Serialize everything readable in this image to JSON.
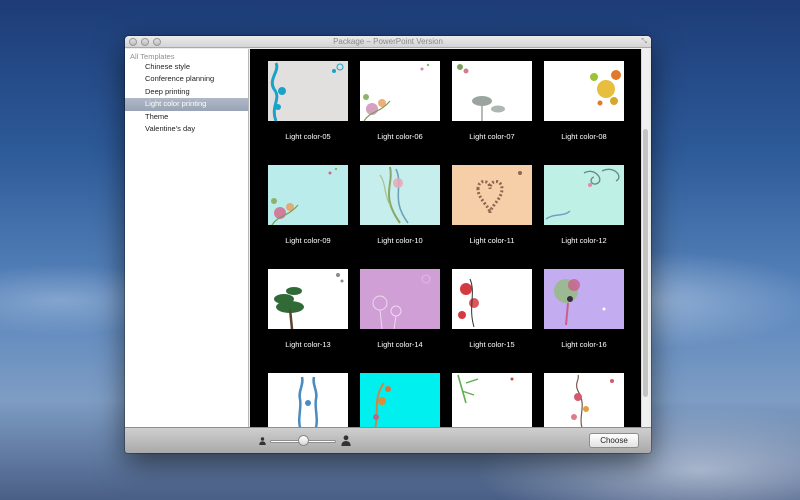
{
  "window": {
    "title": "Package – PowerPoint Version"
  },
  "sidebar": {
    "header": "All Templates",
    "items": [
      {
        "label": "Chinese style"
      },
      {
        "label": "Conference planning"
      },
      {
        "label": "Deep printing"
      },
      {
        "label": "Light color printing",
        "selected": true
      },
      {
        "label": "Theme"
      },
      {
        "label": "Valentine's day"
      }
    ]
  },
  "templates": [
    {
      "label": "Light color-05",
      "bg": "#e2e0de",
      "accent": "#1aa3c8",
      "motif": "left-vine"
    },
    {
      "label": "Light color-06",
      "bg": "#ffffff",
      "accent": "#c98ab0",
      "motif": "bottom-left-floral"
    },
    {
      "label": "Light color-07",
      "bg": "#ffffff",
      "accent": "#9aa5a0",
      "motif": "top-left-lotus"
    },
    {
      "label": "Light color-08",
      "bg": "#ffffff",
      "accent": "#e3b31c",
      "motif": "top-right-circles"
    },
    {
      "label": "Light color-09",
      "bg": "#b9ecea",
      "accent": "#d4648a",
      "motif": "bottom-left-floral"
    },
    {
      "label": "Light color-10",
      "bg": "#c6eeec",
      "accent": "#8ba66b",
      "motif": "center-sprite"
    },
    {
      "label": "Light color-11",
      "bg": "#f6cfa9",
      "accent": "#8f6650",
      "motif": "heart"
    },
    {
      "label": "Light color-12",
      "bg": "#bff0e6",
      "accent": "#6c8a86",
      "motif": "top-right-swirls"
    },
    {
      "label": "Light color-13",
      "bg": "#ffffff",
      "accent": "#2f6a37",
      "motif": "bonsai"
    },
    {
      "label": "Light color-14",
      "bg": "#cf9fd6",
      "accent": "#efd9f0",
      "motif": "dandelions"
    },
    {
      "label": "Light color-15",
      "bg": "#ffffff",
      "accent": "#d43a40",
      "motif": "red-flowers"
    },
    {
      "label": "Light color-16",
      "bg": "#c3acf0",
      "accent": "#c9608c",
      "motif": "fairy"
    },
    {
      "label": "",
      "bg": "#ffffff",
      "accent": "#4a8bc0",
      "motif": "vase"
    },
    {
      "label": "",
      "bg": "#00f0ef",
      "accent": "#c8884a",
      "motif": "orange-vine"
    },
    {
      "label": "",
      "bg": "#ffffff",
      "accent": "#5ab14c",
      "motif": "bamboo"
    },
    {
      "label": "",
      "bg": "#ffffff",
      "accent": "#d45a70",
      "motif": "pink-branch"
    }
  ],
  "footer": {
    "choose_label": "Choose",
    "small_icon": "person-small-icon",
    "large_icon": "person-large-icon",
    "zoom_slider_value": 0.45
  }
}
